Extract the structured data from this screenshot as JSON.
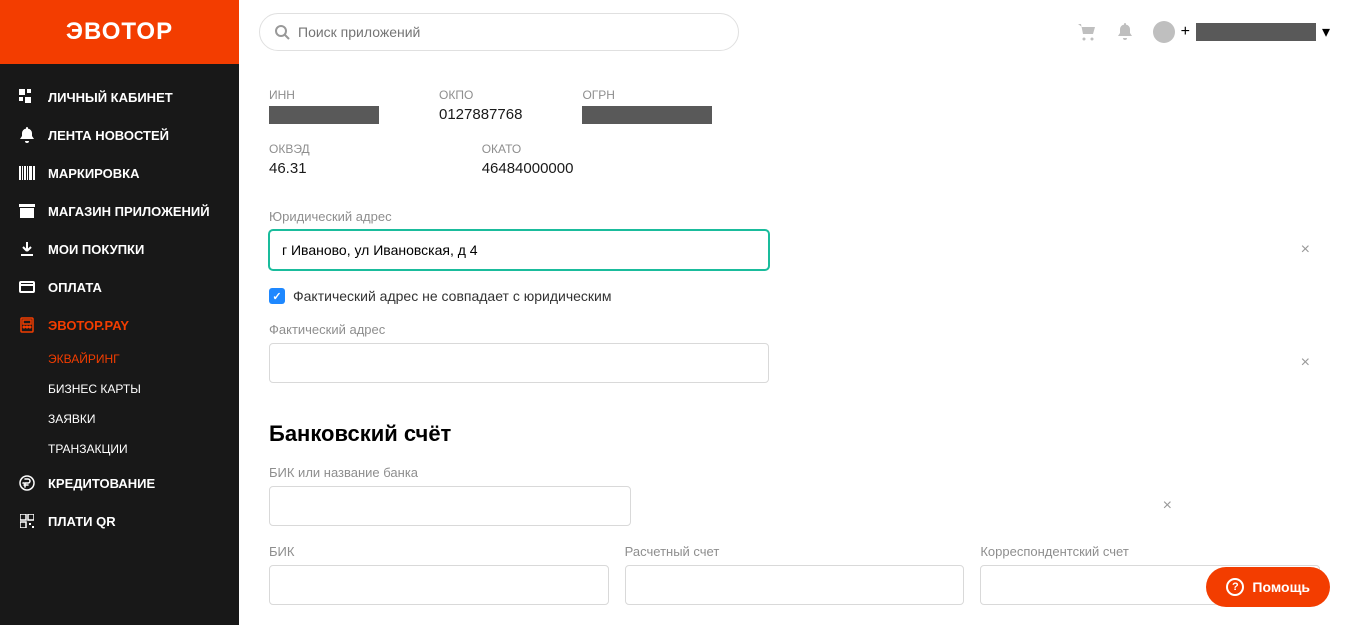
{
  "brand": "ЭВОТОР",
  "search": {
    "placeholder": "Поиск приложений"
  },
  "user": {
    "phone_prefix": "+"
  },
  "sidebar": {
    "items": [
      {
        "label": "ЛИЧНЫЙ КАБИНЕТ"
      },
      {
        "label": "ЛЕНТА НОВОСТЕЙ"
      },
      {
        "label": "МАРКИРОВКА"
      },
      {
        "label": "МАГАЗИН ПРИЛОЖЕНИЙ"
      },
      {
        "label": "МОИ ПОКУПКИ"
      },
      {
        "label": "ОПЛАТА"
      },
      {
        "label": "ЭВОТОР.PAY"
      },
      {
        "label": "КРЕДИТОВАНИЕ"
      },
      {
        "label": "ПЛАТИ QR"
      }
    ],
    "sub": [
      {
        "label": "ЭКВАЙРИНГ"
      },
      {
        "label": "БИЗНЕС КАРТЫ"
      },
      {
        "label": "ЗАЯВКИ"
      },
      {
        "label": "ТРАНЗАКЦИИ"
      }
    ]
  },
  "requisites": {
    "inn": {
      "label": "ИНН",
      "value": ""
    },
    "okpo": {
      "label": "ОКПО",
      "value": "0127887768"
    },
    "ogrn": {
      "label": "ОГРН",
      "value": ""
    },
    "okved": {
      "label": "ОКВЭД",
      "value": "46.31"
    },
    "okato": {
      "label": "ОКАТО",
      "value": "46484000000"
    }
  },
  "address": {
    "legal_label": "Юридический адрес",
    "legal_value": "г Иваново, ул Ивановская, д 4",
    "diff_checkbox": "Фактический адрес не совпадает с юридическим",
    "actual_label": "Фактический адрес",
    "actual_value": ""
  },
  "bank": {
    "heading": "Банковский счёт",
    "search_label": "БИК или название банка",
    "search_value": "",
    "bik_label": "БИК",
    "bik_value": "",
    "rs_label": "Расчетный счет",
    "rs_value": "",
    "ks_label": "Корреспондентский счет",
    "ks_value": ""
  },
  "help": "Помощь"
}
